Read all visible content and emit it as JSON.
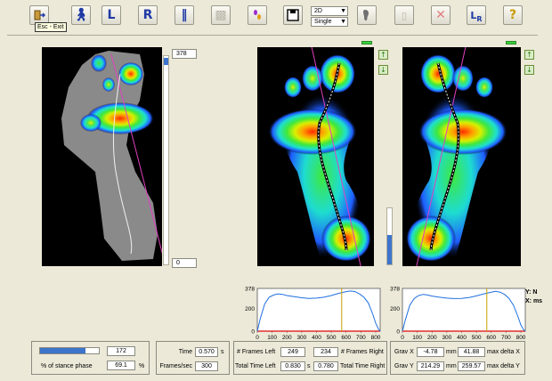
{
  "toolbar": {
    "exit_tooltip": "Esc - Exit",
    "left_label": "L",
    "right_label": "R",
    "view_mode_value": "2D",
    "display_mode_value": "Single",
    "lr_label_main": "L",
    "lr_label_sub": "R",
    "help_label": "?"
  },
  "slider": {
    "max_value": "378",
    "min_value": "0"
  },
  "charts": {
    "legend_y": "Y: N",
    "legend_x": "X: ms"
  },
  "stance": {
    "label": "% of stance phase",
    "progress_fraction": 0.78,
    "value": "172",
    "percent": "69.1",
    "percent_unit": "%"
  },
  "time": {
    "time_label": "Time",
    "time_value": "0.570",
    "time_unit": "s",
    "fps_label": "Frames/sec",
    "fps_value": "300"
  },
  "frames": {
    "frames_left_label": "# Frames Left",
    "frames_left_value": "249",
    "frames_right_value": "234",
    "frames_right_label": "# Frames Right",
    "total_left_label": "Total Time Left",
    "total_left_value": "0.830",
    "total_left_unit": "s",
    "total_right_value": "0.780",
    "total_right_label": "Total Time Right"
  },
  "grav": {
    "x_label": "Grav X",
    "x_value": "-4.78",
    "x_unit": "mm",
    "max_dx_value": "41.88",
    "max_dx_label": "max delta X",
    "y_label": "Grav Y",
    "y_value": "214.29",
    "y_unit": "mm",
    "max_dy_value": "259.57",
    "max_dy_label": "max delta Y"
  },
  "chart_data": [
    {
      "type": "line",
      "title": "",
      "xlabel": "",
      "ylabel": "",
      "xlim": [
        0,
        830
      ],
      "ylim": [
        0,
        378
      ],
      "x_ticks": [
        0,
        100,
        200,
        300,
        400,
        500,
        600,
        700,
        800
      ],
      "y_ticks": [
        0,
        200,
        378
      ],
      "cursor_x": 570,
      "series": [
        {
          "color": "#1e6fe0",
          "x": [
            0,
            20,
            50,
            80,
            110,
            140,
            170,
            200,
            250,
            300,
            350,
            400,
            450,
            500,
            550,
            600,
            630,
            660,
            690,
            720,
            750,
            780,
            800,
            820,
            830
          ],
          "y": [
            0,
            110,
            240,
            300,
            320,
            330,
            325,
            315,
            305,
            295,
            290,
            292,
            300,
            315,
            335,
            350,
            355,
            350,
            330,
            300,
            250,
            150,
            70,
            15,
            0
          ]
        }
      ]
    },
    {
      "type": "line",
      "title": "",
      "xlabel": "",
      "ylabel": "",
      "xlim": [
        0,
        830
      ],
      "ylim": [
        0,
        378
      ],
      "x_ticks": [
        0,
        100,
        200,
        300,
        400,
        500,
        600,
        700,
        800
      ],
      "y_ticks": [
        0,
        200,
        378
      ],
      "cursor_x": 570,
      "series": [
        {
          "color": "#1e6fe0",
          "x": [
            0,
            20,
            50,
            80,
            110,
            140,
            170,
            200,
            250,
            300,
            350,
            400,
            450,
            500,
            550,
            600,
            630,
            660,
            690,
            720,
            750,
            780,
            800,
            820,
            830
          ],
          "y": [
            0,
            100,
            230,
            290,
            315,
            325,
            320,
            310,
            300,
            292,
            288,
            290,
            298,
            312,
            330,
            345,
            352,
            345,
            325,
            290,
            230,
            130,
            55,
            10,
            0
          ]
        }
      ]
    }
  ]
}
